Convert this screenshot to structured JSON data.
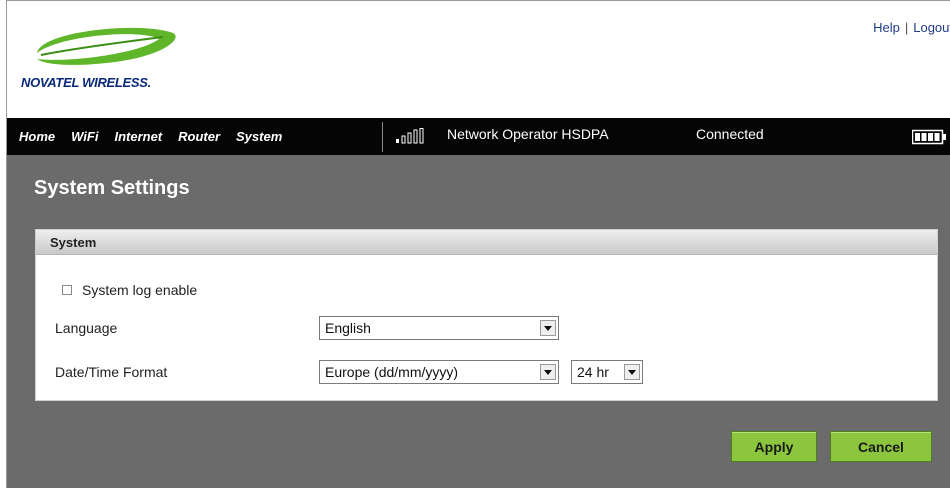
{
  "header": {
    "logo_text": "NOVATEL WIRELESS.",
    "help_label": "Help",
    "logout_label": "Logout",
    "separator": "|"
  },
  "nav": {
    "items": [
      {
        "label": "Home"
      },
      {
        "label": "WiFi"
      },
      {
        "label": "Internet"
      },
      {
        "label": "Router"
      },
      {
        "label": "System"
      }
    ],
    "signal_icon": "signal-bars-icon",
    "operator_text": "Network Operator  HSDPA",
    "status_text": "Connected",
    "battery_icon": "battery-icon"
  },
  "page": {
    "title": "System Settings"
  },
  "panel": {
    "title": "System",
    "system_log": {
      "label": "System log enable",
      "checked": false
    },
    "language": {
      "label": "Language",
      "value": "English"
    },
    "datetime": {
      "label": "Date/Time Format",
      "format_value": "Europe (dd/mm/yyyy)",
      "hour_value": "24 hr"
    }
  },
  "actions": {
    "apply_label": "Apply",
    "cancel_label": "Cancel"
  },
  "colors": {
    "nav_bg": "#050505",
    "content_bg": "#6b6b6b",
    "button_green": "#8cc63f",
    "logo_green": "#5fb62a",
    "logo_blue": "#0a2a78"
  }
}
